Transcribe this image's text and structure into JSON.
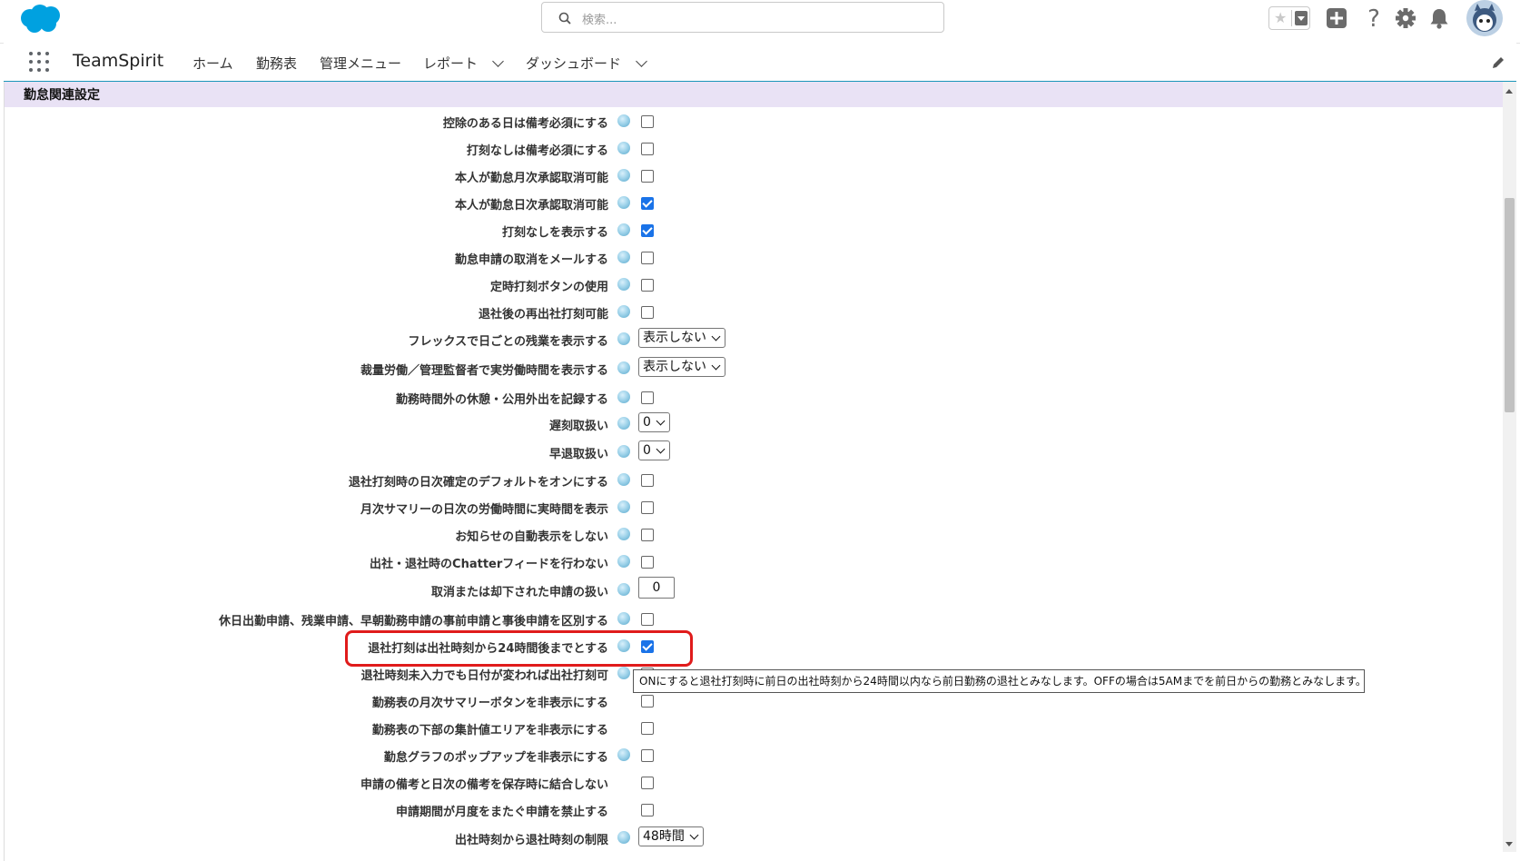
{
  "header": {
    "search_placeholder": "検索...",
    "icons": [
      "salesforce-cloud-icon",
      "search-icon",
      "star-icon",
      "add-icon",
      "help-icon",
      "setup-gear-icon",
      "notification-bell-icon",
      "avatar"
    ]
  },
  "nav": {
    "app_name": "TeamSpirit",
    "items": [
      {
        "label": "ホーム"
      },
      {
        "label": "勤務表"
      },
      {
        "label": "管理メニュー"
      },
      {
        "label": "レポート"
      },
      {
        "label": "ダッシュボード"
      }
    ]
  },
  "section": {
    "title": "勤怠関連設定"
  },
  "rows": [
    {
      "label": "控除のある日は備考必須にする",
      "type": "checkbox",
      "checked": false,
      "help": true
    },
    {
      "label": "打刻なしは備考必須にする",
      "type": "checkbox",
      "checked": false,
      "help": true
    },
    {
      "label": "本人が勤怠月次承認取消可能",
      "type": "checkbox",
      "checked": false,
      "help": true
    },
    {
      "label": "本人が勤怠日次承認取消可能",
      "type": "checkbox",
      "checked": true,
      "help": true
    },
    {
      "label": "打刻なしを表示する",
      "type": "checkbox",
      "checked": true,
      "help": true
    },
    {
      "label": "勤怠申請の取消をメールする",
      "type": "checkbox",
      "checked": false,
      "help": true
    },
    {
      "label": "定時打刻ボタンの使用",
      "type": "checkbox",
      "checked": false,
      "help": true
    },
    {
      "label": "退社後の再出社打刻可能",
      "type": "checkbox",
      "checked": false,
      "help": true
    },
    {
      "label": "フレックスで日ごとの残業を表示する",
      "type": "select",
      "value": "表示しない",
      "help": true
    },
    {
      "label": "裁量労働／管理監督者で実労働時間を表示する",
      "type": "select",
      "value": "表示しない",
      "help": true
    },
    {
      "label": "勤務時間外の休憩・公用外出を記録する",
      "type": "checkbox",
      "checked": false,
      "help": true
    },
    {
      "label": "遅刻取扱い",
      "type": "select",
      "value": "0",
      "help": true
    },
    {
      "label": "早退取扱い",
      "type": "select",
      "value": "0",
      "help": true
    },
    {
      "label": "退社打刻時の日次確定のデフォルトをオンにする",
      "type": "checkbox",
      "checked": false,
      "help": true
    },
    {
      "label": "月次サマリーの日次の労働時間に実時間を表示",
      "type": "checkbox",
      "checked": false,
      "help": true
    },
    {
      "label": "お知らせの自動表示をしない",
      "type": "checkbox",
      "checked": false,
      "help": true
    },
    {
      "label": "出社・退社時のChatterフィードを行わない",
      "type": "checkbox",
      "checked": false,
      "help": true
    },
    {
      "label": "取消または却下された申請の扱い",
      "type": "number",
      "value": "0",
      "help": true
    },
    {
      "label": "休日出勤申請、残業申請、早朝勤務申請の事前申請と事後申請を区別する",
      "type": "checkbox",
      "checked": false,
      "help": true
    },
    {
      "label": "退社打刻は出社時刻から24時間後までとする",
      "type": "checkbox",
      "checked": true,
      "help": true
    },
    {
      "label": "退社時刻未入力でも日付が変われば出社打刻可",
      "type": "checkbox",
      "checked": false,
      "help": true
    },
    {
      "label": "勤務表の月次サマリーボタンを非表示にする",
      "type": "checkbox",
      "checked": false,
      "help": false
    },
    {
      "label": "勤務表の下部の集計値エリアを非表示にする",
      "type": "checkbox",
      "checked": false,
      "help": false
    },
    {
      "label": "勤怠グラフのポップアップを非表示にする",
      "type": "checkbox",
      "checked": false,
      "help": true
    },
    {
      "label": "申請の備考と日次の備考を保存時に結合しない",
      "type": "checkbox",
      "checked": false,
      "help": false
    },
    {
      "label": "申請期間が月度をまたぐ申請を禁止する",
      "type": "checkbox",
      "checked": false,
      "help": false
    },
    {
      "label": "出社時刻から退社時刻の制限",
      "type": "select",
      "value": "48時間",
      "help": true
    }
  ],
  "tooltip": {
    "text": "ONにすると退社打刻時に前日の出社時刻から24時間以内なら前日勤務の退社とみなします。OFFの場合は5AMまでを前日からの勤務とみなします。"
  },
  "colors": {
    "accent": "#1b96b9",
    "section_bg": "#e9e2f5",
    "highlight": "#e01b1b",
    "checkbox_on": "#1a73e8"
  }
}
